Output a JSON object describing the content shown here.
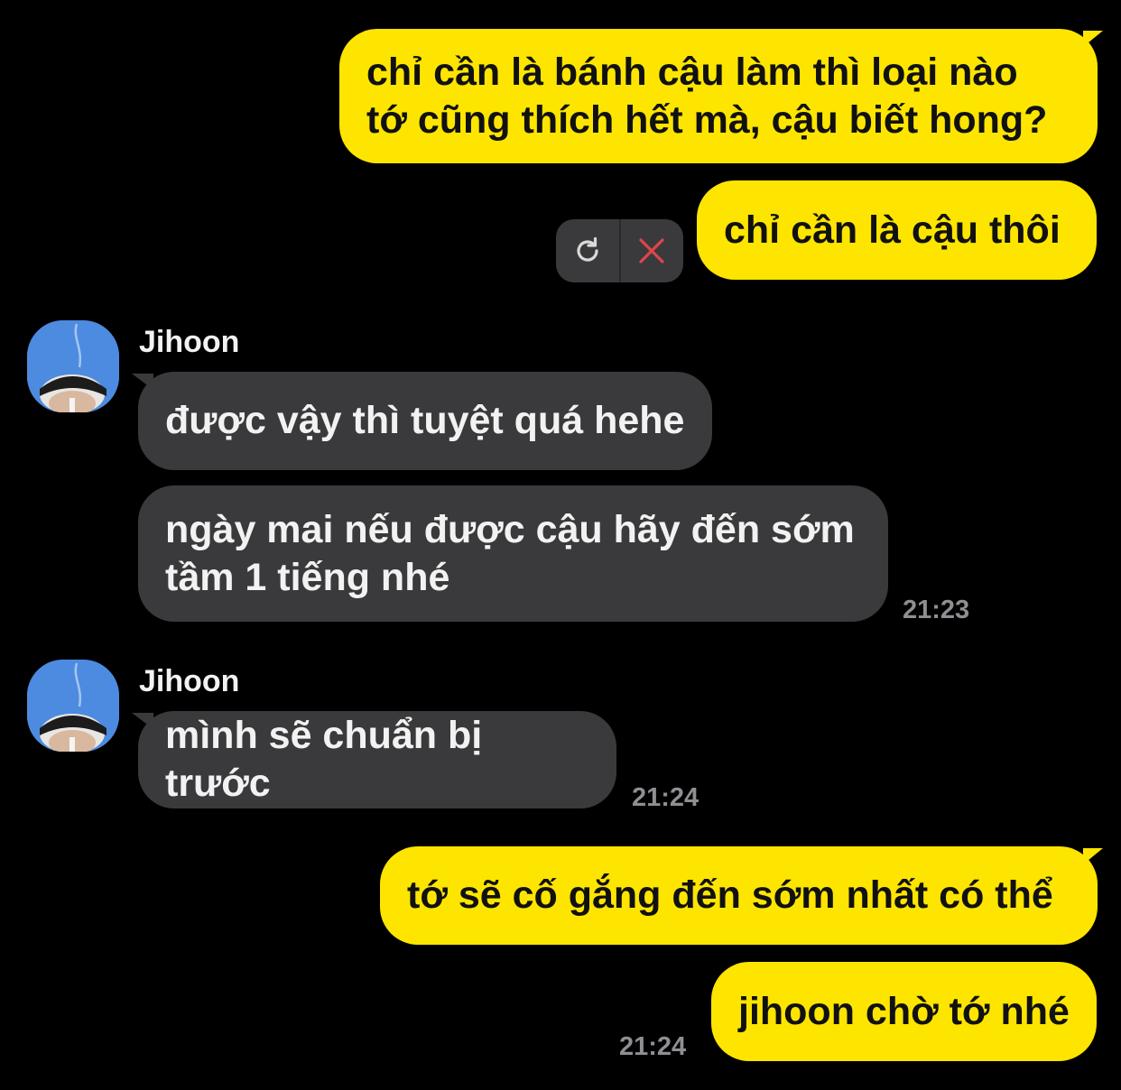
{
  "messages": {
    "m1": "chỉ cần là bánh cậu làm thì loại nào\ntớ cũng thích hết mà, cậu biết hong?",
    "m2": "chỉ cần là cậu thôi",
    "m3": "được vậy thì tuyệt quá hehe",
    "m4": "ngày mai nếu được cậu hãy đến sớm\ntầm 1 tiếng nhé",
    "m5": "mình sẽ chuẩn bị trước",
    "m6": "tớ sẽ cố gắng đến sớm nhất có thể",
    "m7": "jihoon chờ tớ nhé"
  },
  "senders": {
    "group1": "Jihoon",
    "group2": "Jihoon"
  },
  "times": {
    "t1": "21:23",
    "t2": "21:24",
    "t3": "21:24"
  },
  "failed_actions": {
    "retry_icon": "refresh-icon",
    "delete_icon": "close-icon"
  },
  "colors": {
    "background": "#000000",
    "my_bubble": "#fde500",
    "their_bubble": "#3a3a3c",
    "delete_red": "#e0454a",
    "timestamp": "#8e8e93"
  }
}
